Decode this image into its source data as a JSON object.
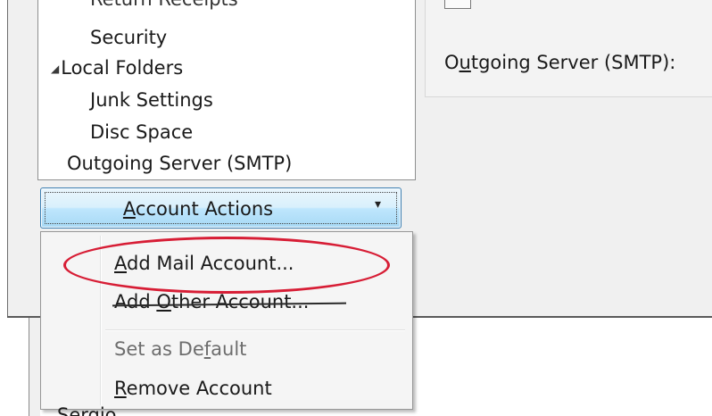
{
  "tree": {
    "items": [
      {
        "label": "Return Receipts"
      },
      {
        "label": "Security"
      },
      {
        "label": "Local Folders"
      },
      {
        "label": "Junk Settings"
      },
      {
        "label": "Disc Space"
      },
      {
        "label": "Outgoing Server (SMTP)"
      }
    ],
    "expanded_icon": "triangle-expanded-icon"
  },
  "right_panel": {
    "outgoing_label_pre": "O",
    "outgoing_label_u": "u",
    "outgoing_label_post": "tgoing Server (SMTP):"
  },
  "account_actions": {
    "label_pre": "",
    "label_u": "A",
    "label_post": "ccount Actions",
    "arrow": "▾"
  },
  "menu": {
    "add_mail": {
      "pre": "",
      "u": "A",
      "post": "dd Mail Account..."
    },
    "add_other": {
      "pre": "Add ",
      "u": "O",
      "post": "ther Account..."
    },
    "set_default": {
      "pre": "Set as De",
      "u": "f",
      "post": "ault"
    },
    "remove": {
      "pre": "",
      "u": "R",
      "post": "emove Account"
    }
  },
  "bottom": {
    "partial_label": "Sergio"
  },
  "colors": {
    "highlight": "#d71d35",
    "button_border": "#3c7fb1"
  }
}
